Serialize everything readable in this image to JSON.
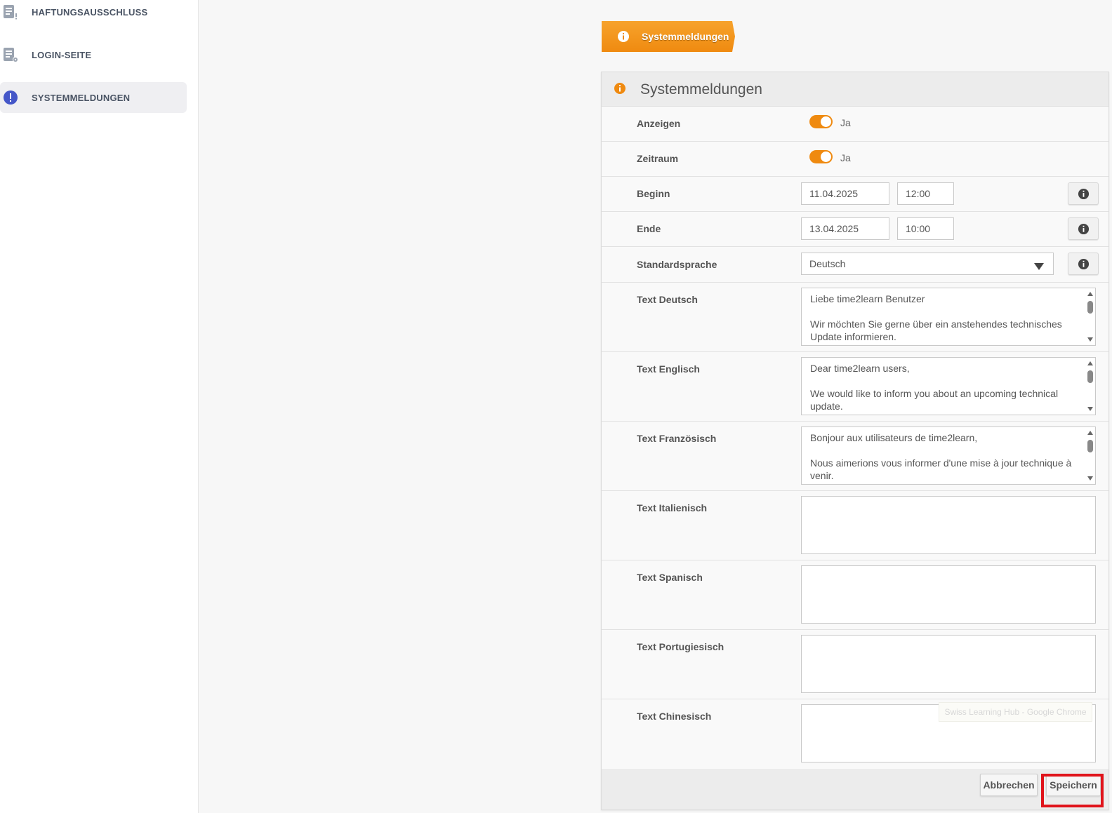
{
  "sidebar": {
    "items": [
      {
        "label": "HAFTUNGSAUSSCHLUSS",
        "icon": "document-warning-icon",
        "active": false
      },
      {
        "label": "LOGIN-SEITE",
        "icon": "document-settings-icon",
        "active": false
      },
      {
        "label": "SYSTEMMELDUNGEN",
        "icon": "exclamation-circle-icon",
        "active": true
      }
    ]
  },
  "breadcrumb": {
    "label": "Systemmeldungen",
    "icon": "info-circle-icon"
  },
  "panel": {
    "title": "Systemmeldungen",
    "fields": {
      "anzeigen": {
        "label": "Anzeigen",
        "value": "Ja",
        "on": true
      },
      "zeitraum": {
        "label": "Zeitraum",
        "value": "Ja",
        "on": true
      },
      "beginn": {
        "label": "Beginn",
        "date": "11.04.2025",
        "time": "12:00"
      },
      "ende": {
        "label": "Ende",
        "date": "13.04.2025",
        "time": "10:00"
      },
      "standardsprache": {
        "label": "Standardsprache",
        "value": "Deutsch"
      },
      "texts": [
        {
          "label": "Text Deutsch",
          "value": "Liebe time2learn Benutzer\n\nWir möchten Sie gerne über ein anstehendes technisches Update informieren."
        },
        {
          "label": "Text Englisch",
          "value": "Dear time2learn users,\n\nWe would like to inform you about an upcoming technical update."
        },
        {
          "label": "Text Französisch",
          "value": "Bonjour aux utilisateurs de time2learn,\n\nNous aimerions vous informer d'une mise à jour technique à venir."
        },
        {
          "label": "Text Italienisch",
          "value": ""
        },
        {
          "label": "Text Spanisch",
          "value": ""
        },
        {
          "label": "Text Portugiesisch",
          "value": ""
        },
        {
          "label": "Text Chinesisch",
          "value": ""
        }
      ]
    },
    "buttons": {
      "cancel": "Abbrechen",
      "save": "Speichern"
    }
  },
  "tooltip": "Swiss Learning Hub - Google Chrome",
  "colors": {
    "accent": "#ef8a10",
    "active_nav_icon": "#4456c8",
    "highlight": "#e0141b"
  }
}
